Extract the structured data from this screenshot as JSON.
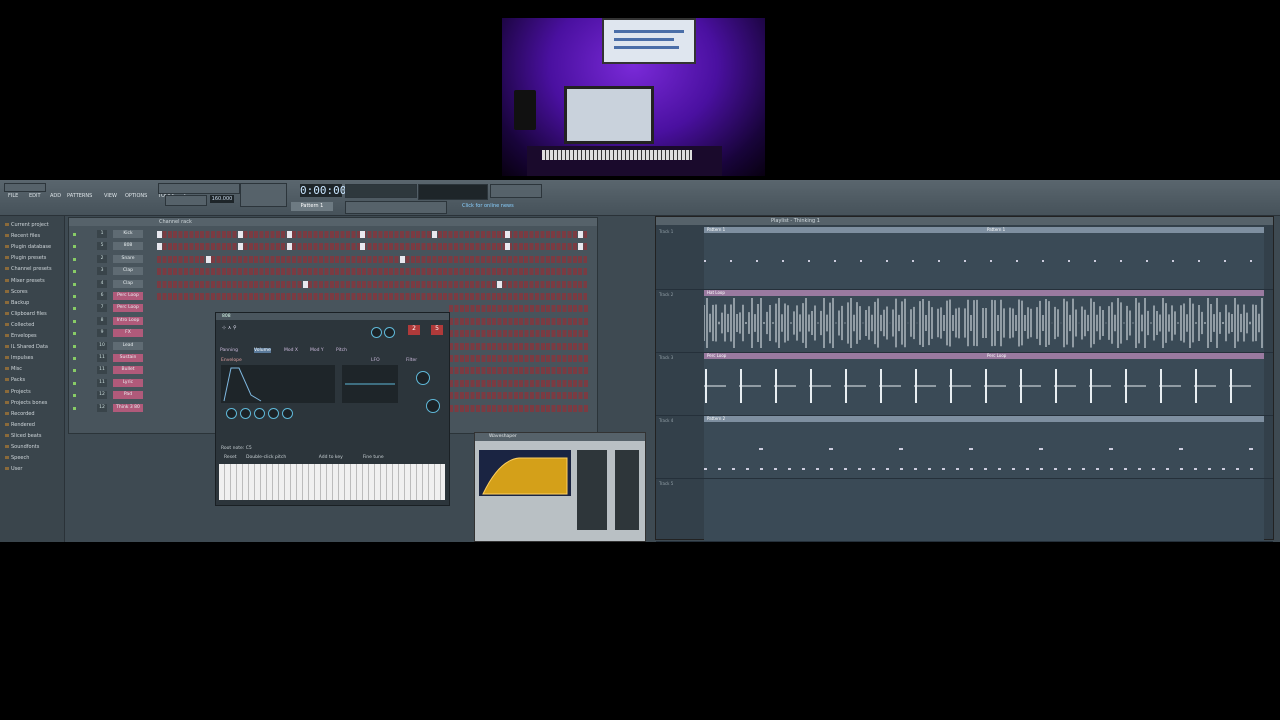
{
  "webcam": {
    "alt_label": "studio webcam"
  },
  "menu": [
    "FILE",
    "EDIT",
    "ADD",
    "PATTERNS",
    "VIEW",
    "OPTIONS",
    "TOOLS",
    "?"
  ],
  "transport": {
    "time": "0:00:00",
    "tempo": "160.000",
    "pattern": "Pattern 1",
    "news": "Click for online news"
  },
  "browser": {
    "items": [
      "Current project",
      "Recent files",
      "Plugin database",
      "Plugin presets",
      "Channel presets",
      "Mixer presets",
      "Scores",
      "Backup",
      "Clipboard files",
      "Collected",
      "Envelopes",
      "IL Shared Data",
      "Impulses",
      "Misc",
      "Packs",
      "Projects",
      "Projects bones",
      "Recorded",
      "Rendered",
      "Sliced beats",
      "Soundfonts",
      "Speech",
      "User"
    ]
  },
  "rack": {
    "title": "Channel rack",
    "channels": [
      {
        "num": "1",
        "name": "Kick",
        "pink": false
      },
      {
        "num": "5",
        "name": "808",
        "pink": false
      },
      {
        "num": "2",
        "name": "Snare",
        "pink": false
      },
      {
        "num": "3",
        "name": "Clap",
        "pink": false
      },
      {
        "num": "4",
        "name": "Clap",
        "pink": false
      },
      {
        "num": "6",
        "name": "Perc Loop",
        "pink": true
      },
      {
        "num": "7",
        "name": "Perc Loop",
        "pink": true
      },
      {
        "num": "8",
        "name": "Intro Loop",
        "pink": true
      },
      {
        "num": "9",
        "name": "FX",
        "pink": true
      },
      {
        "num": "10",
        "name": "Lead",
        "pink": false
      },
      {
        "num": "11",
        "name": "Sustain",
        "pink": true
      },
      {
        "num": "11",
        "name": "Bullet",
        "pink": true
      },
      {
        "num": "11",
        "name": "Lyric",
        "pink": true
      },
      {
        "num": "12",
        "name": "Pad",
        "pink": true
      },
      {
        "num": "12",
        "name": "Think 3 80",
        "pink": true
      }
    ]
  },
  "synth": {
    "title": "808",
    "tabs": [
      "Panning",
      "Volume",
      "Mod X",
      "Mod Y",
      "Pitch"
    ],
    "env_label": "Envelope",
    "lfo_label": "LFO",
    "filter_label": "Filter",
    "root_note": "Root note: C5",
    "reset": "Reset",
    "options": [
      "Double-click pitch",
      "Add to key",
      "Fine tune"
    ]
  },
  "fx": {
    "title": "Waveshaper"
  },
  "playlist": {
    "title": "Playlist - Thinking 1",
    "tracks": [
      {
        "label": "Track 1",
        "clips": [
          {
            "name": "Pattern 1",
            "pink": false
          },
          {
            "name": "Pattern 1",
            "pink": false
          }
        ],
        "type": "dots"
      },
      {
        "label": "Track 2",
        "clips": [
          {
            "name": "Hat Loop",
            "pink": true
          }
        ],
        "type": "dense"
      },
      {
        "label": "Track 3",
        "clips": [
          {
            "name": "Perc Loop",
            "pink": true
          },
          {
            "name": "Perc Loop",
            "pink": true
          }
        ],
        "type": "sparse"
      },
      {
        "label": "Track 4",
        "clips": [
          {
            "name": "Pattern 2",
            "pink": false
          }
        ],
        "type": "dots2"
      },
      {
        "label": "Track 5",
        "clips": [],
        "type": "empty"
      }
    ]
  }
}
